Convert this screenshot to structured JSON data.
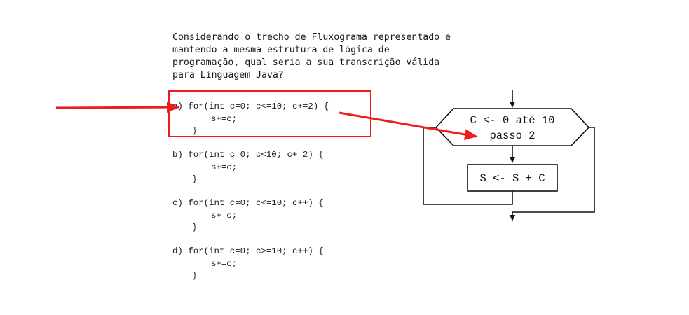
{
  "question": {
    "lines": [
      "Considerando o trecho de Fluxograma representado e",
      "mantendo a mesma estrutura de lógica de",
      "programação, qual seria a sua transcrição válida",
      "para Linguagem Java?"
    ]
  },
  "options": [
    {
      "line1": "a) for(int c=0; c<=10; c+=2) {",
      "line2": "s+=c;",
      "line3": "}"
    },
    {
      "line1": "b) for(int c=0; c<10; c+=2) {",
      "line2": "s+=c;",
      "line3": "}"
    },
    {
      "line1": "c) for(int c=0; c<=10; c++) {",
      "line2": "s+=c;",
      "line3": "}"
    },
    {
      "line1": "d) for(int c=0; c>=10; c++) {",
      "line2": "s+=c;",
      "line3": "}"
    }
  ],
  "flowchart": {
    "loop_line1": "C <- 0 até 10",
    "loop_line2": "passo 2",
    "process": "S <- S + C"
  },
  "colors": {
    "highlight": "#ee1c1c",
    "line": "#111111"
  }
}
